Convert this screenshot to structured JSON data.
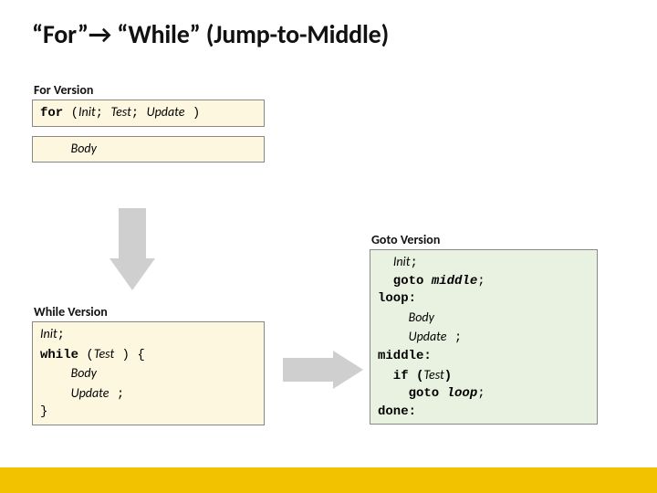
{
  "title_a": "“For”",
  "title_b": "“While” (Jump-to-Middle)",
  "for": {
    "label": "For Version",
    "line1_kw": "for",
    "line1_rest_a": " (",
    "line1_init": "Init",
    "line1_sep1": "; ",
    "line1_test": "Test",
    "line1_sep2": "; ",
    "line1_upd": "Update",
    "line1_rest_b": " )",
    "body": "Body"
  },
  "while": {
    "label": "While Version",
    "l1": "Init",
    "l1_tail": ";",
    "l2_kw": "while",
    "l2_a": " (",
    "l2_test": "Test",
    "l2_b": " ) {",
    "l3": "Body",
    "l4": "Update",
    "l4_tail": " ;",
    "l5": "}"
  },
  "goto": {
    "label": "Goto Version",
    "l1": "Init",
    "l1_tail": ";",
    "l2a": "  goto ",
    "l2b": "middle",
    "l2c": ";",
    "l3": "loop:",
    "l4": "Body",
    "l5": "Update",
    "l5_tail": " ;",
    "l6": "middle:",
    "l7a": "  if (",
    "l7b": "Test",
    "l7c": ")",
    "l8a": "    goto ",
    "l8b": "loop",
    "l8c": ";",
    "l9": "done:"
  }
}
